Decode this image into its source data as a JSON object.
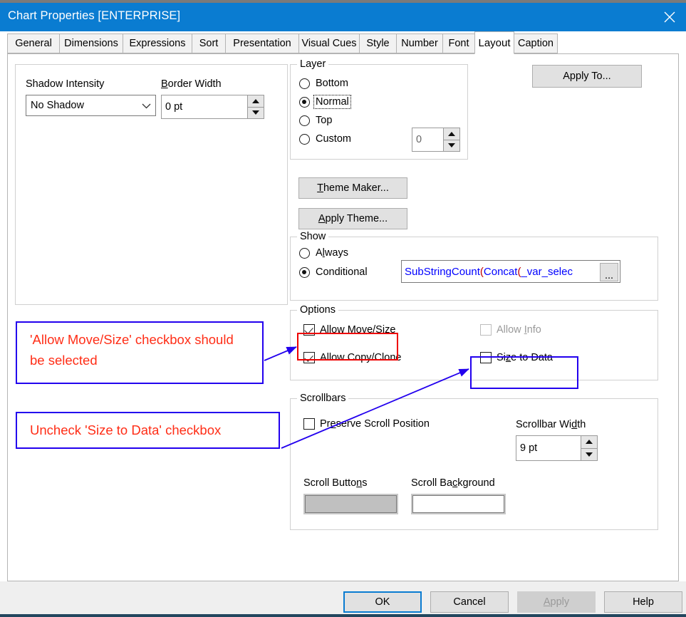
{
  "window": {
    "title": "Chart Properties [ENTERPRISE]",
    "close_icon": "close-icon",
    "accent_color": "#0a7cd1",
    "annotation_color": "#ff2d16",
    "annotation_border_color": "#2200ee",
    "highlight_color": "#ee0000"
  },
  "tabs": [
    {
      "label": "General",
      "active": false
    },
    {
      "label": "Dimensions",
      "active": false
    },
    {
      "label": "Expressions",
      "active": false
    },
    {
      "label": "Sort",
      "active": false
    },
    {
      "label": "Presentation",
      "active": false
    },
    {
      "label": "Visual Cues",
      "active": false
    },
    {
      "label": "Style",
      "active": false
    },
    {
      "label": "Number",
      "active": false
    },
    {
      "label": "Font",
      "active": false
    },
    {
      "label": "Layout",
      "active": true
    },
    {
      "label": "Caption",
      "active": false
    }
  ],
  "left_panel": {
    "shadow_intensity": {
      "label": "Shadow Intensity",
      "value": "No Shadow",
      "arrow_icon": "chevron-down-icon"
    },
    "border_width": {
      "label": "Border Width",
      "label_accel": "B",
      "value": "0 pt",
      "up_icon": "spinner-up-icon",
      "down_icon": "spinner-down-icon"
    }
  },
  "layer": {
    "legend": "Layer",
    "options": [
      {
        "label": "Bottom",
        "selected": false,
        "focused": false
      },
      {
        "label": "Normal",
        "selected": true,
        "focused": true
      },
      {
        "label": "Top",
        "selected": false,
        "focused": false
      },
      {
        "label": "Custom",
        "selected": false,
        "focused": false
      }
    ],
    "custom_value": "0"
  },
  "buttons": {
    "apply_to": "Apply To...",
    "theme_maker": "Theme Maker...",
    "apply_theme": "Apply Theme..."
  },
  "show": {
    "legend": "Show",
    "always": {
      "label": "Always",
      "selected": false
    },
    "conditional": {
      "label": "Conditional",
      "selected": true
    },
    "expression": {
      "full_text": "SubStringCount(Concat(_var_selec",
      "segments": [
        {
          "t": "SubStringCount",
          "kind": "fn"
        },
        {
          "t": "(",
          "kind": "paren"
        },
        {
          "t": "Concat",
          "kind": "fn"
        },
        {
          "t": "(",
          "kind": "paren"
        },
        {
          "t": "_var_selec",
          "kind": "fn"
        }
      ],
      "ellipsis_label": "..."
    }
  },
  "options": {
    "legend": "Options",
    "items": [
      {
        "label": "Allow Move/Size",
        "checked": true,
        "disabled": false,
        "accel": "w"
      },
      {
        "label": "Allow Copy/Clone",
        "checked": true,
        "disabled": false,
        "accel": ""
      },
      {
        "label": "Allow Info",
        "checked": false,
        "disabled": true,
        "accel": "I"
      },
      {
        "label": "Size to Data",
        "checked": false,
        "disabled": false,
        "accel": "z"
      }
    ]
  },
  "scrollbars": {
    "legend": "Scrollbars",
    "preserve_scroll_position": {
      "label": "Preserve Scroll Position",
      "checked": false
    },
    "scrollbar_width": {
      "label": "Scrollbar Width",
      "value": "9 pt"
    },
    "scroll_buttons": {
      "label": "Scroll Buttons",
      "color": "#c0c0c0"
    },
    "scroll_background": {
      "label": "Scroll Background",
      "color": "#ffffff"
    }
  },
  "annotations": [
    {
      "text": "'Allow Move/Size' checkbox should be selected"
    },
    {
      "text": "Uncheck 'Size to Data' checkbox"
    }
  ],
  "footer": {
    "ok": "OK",
    "cancel": "Cancel",
    "apply": "Apply",
    "help": "Help"
  }
}
